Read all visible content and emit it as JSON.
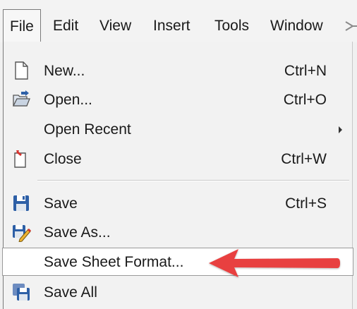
{
  "menubar": {
    "items": [
      {
        "label": "File",
        "active": true
      },
      {
        "label": "Edit"
      },
      {
        "label": "View"
      },
      {
        "label": "Insert"
      },
      {
        "label": "Tools"
      },
      {
        "label": "Window"
      }
    ],
    "overflow_icon": "pin-icon"
  },
  "file_menu": {
    "items": [
      {
        "label": "New...",
        "shortcut": "Ctrl+N",
        "icon": "new-document-icon"
      },
      {
        "label": "Open...",
        "shortcut": "Ctrl+O",
        "icon": "open-folder-icon"
      },
      {
        "label": "Open Recent",
        "shortcut": "",
        "icon": "",
        "submenu": true
      },
      {
        "label": "Close",
        "shortcut": "Ctrl+W",
        "icon": "close-document-icon"
      },
      {
        "label": "Save",
        "shortcut": "Ctrl+S",
        "icon": "save-icon"
      },
      {
        "label": "Save As...",
        "shortcut": "",
        "icon": "save-as-icon"
      },
      {
        "label": "Save Sheet Format...",
        "shortcut": "",
        "icon": "",
        "highlighted": true
      },
      {
        "label": "Save All",
        "shortcut": "",
        "icon": "save-all-icon"
      }
    ]
  },
  "annotation": {
    "type": "red-arrow",
    "points_to": "Save Sheet Format...",
    "color": "#e8413f"
  },
  "colors": {
    "menu_bg": "#f2f2f2",
    "highlight_bg": "#ffffff",
    "icon_blue": "#2d5fa6",
    "arrow_red": "#e8413f"
  }
}
